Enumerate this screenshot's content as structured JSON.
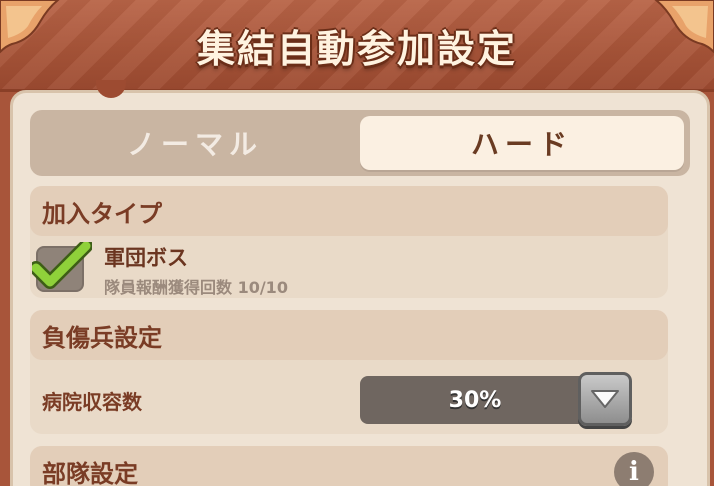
{
  "header": {
    "title": "集結自動参加設定"
  },
  "tabs": [
    {
      "label": "ノーマル",
      "selected": false
    },
    {
      "label": "ハード",
      "selected": true
    }
  ],
  "join_type": {
    "title": "加入タイプ",
    "option": {
      "name": "軍団ボス",
      "subtitle": "隊員報酬獲得回数 10/10",
      "checked": true
    }
  },
  "wounded": {
    "title": "負傷兵設定",
    "hospital_label": "病院収容数",
    "hospital_value": "30%"
  },
  "troops": {
    "title": "部隊設定"
  },
  "icons": {
    "check": "checkmark-icon",
    "dropdown": "chevron-down-icon",
    "info": "info-icon"
  },
  "colors": {
    "header_bg": "#a95539",
    "panel_bg": "#efe3d4",
    "accent_text": "#7a3c25",
    "check_green": "#8fd13a"
  }
}
